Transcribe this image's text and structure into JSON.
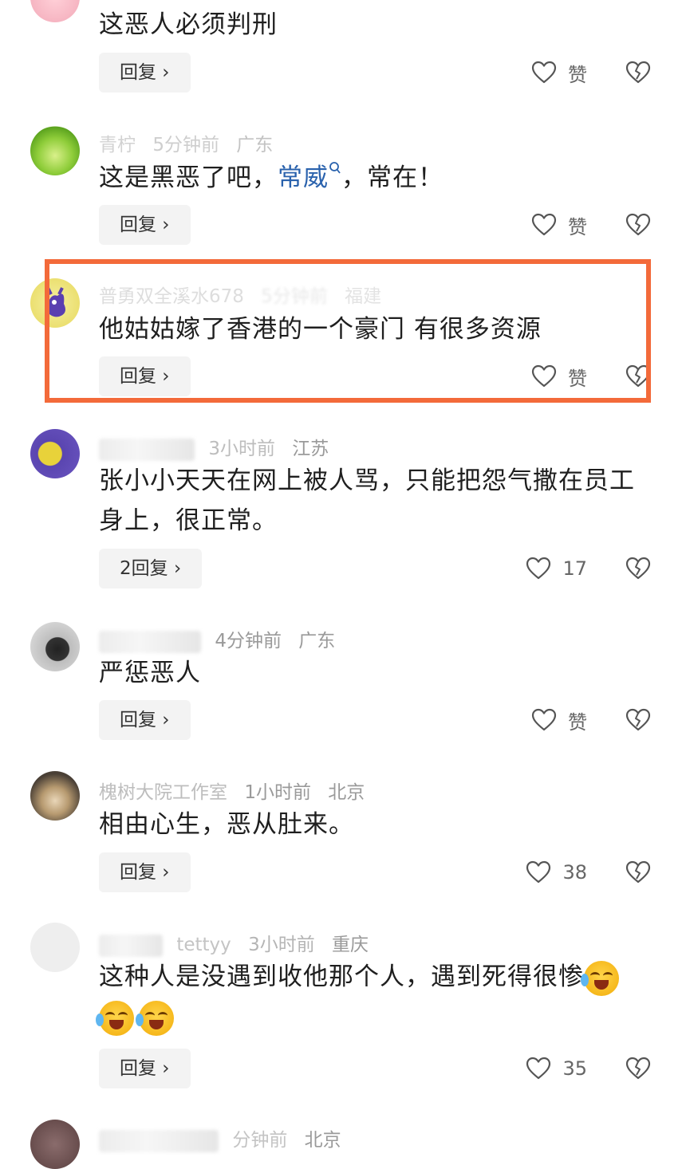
{
  "comments": [
    {
      "meta": {
        "user": "",
        "time": "",
        "location": ""
      },
      "text": "这恶人必须判刑",
      "reply": "回复 ›",
      "likes": "赞"
    },
    {
      "meta": {
        "user": "青柠",
        "time": "5分钟前",
        "location": "广东"
      },
      "text_before": "这是黑恶了吧，",
      "text_link": "常威",
      "text_after": "，常在！",
      "reply": "回复 ›",
      "likes": "赞"
    },
    {
      "meta": {
        "user": "普勇双全溪水678",
        "time": "5分钟前",
        "location": "福建"
      },
      "text": "他姑姑嫁了香港的一个豪门 有很多资源",
      "reply": "回复 ›",
      "likes": "赞"
    },
    {
      "meta": {
        "user": "",
        "time": "3小时前",
        "location": "江苏"
      },
      "text": "张小小天天在网上被人骂，只能把怨气撒在员工身上，很正常。",
      "reply": "2回复 ›",
      "likes": "17"
    },
    {
      "meta": {
        "user": "",
        "time": "4分钟前",
        "location": "广东"
      },
      "text": "严惩恶人",
      "reply": "回复 ›",
      "likes": "赞"
    },
    {
      "meta": {
        "user": "槐树大院工作室",
        "time": "1小时前",
        "location": "北京"
      },
      "text": "相由心生，恶从肚来。",
      "reply": "回复 ›",
      "likes": "38"
    },
    {
      "meta": {
        "user": "tettyy",
        "time": "3小时前",
        "location": "重庆"
      },
      "text": "这种人是没遇到收他那个人，遇到死得很惨",
      "reply": "回复 ›",
      "likes": "35"
    },
    {
      "meta": {
        "user": "",
        "time": "分钟前",
        "location": "北京"
      }
    }
  ],
  "colors": {
    "highlight": "#f36a3a",
    "link": "#2a62ad",
    "meta": "#9a9a9a"
  },
  "icons": [
    "heart-icon",
    "broken-heart-icon",
    "search-icon",
    "laughing-crying-emoji"
  ]
}
